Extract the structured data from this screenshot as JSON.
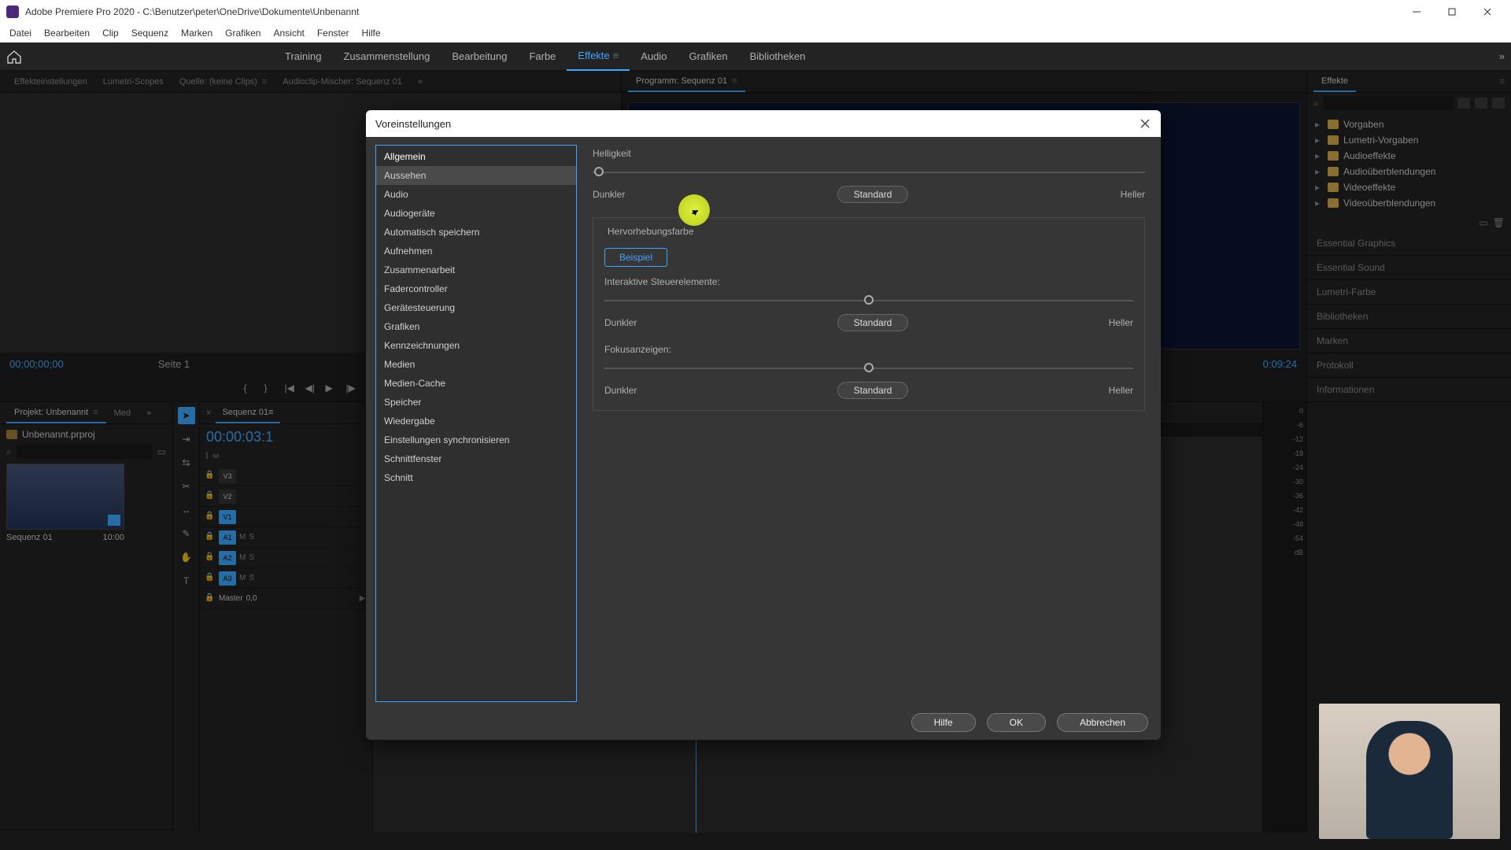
{
  "window": {
    "title": "Adobe Premiere Pro 2020 - C:\\Benutzer\\peter\\OneDrive\\Dokumente\\Unbenannt"
  },
  "menu": [
    "Datei",
    "Bearbeiten",
    "Clip",
    "Sequenz",
    "Marken",
    "Grafiken",
    "Ansicht",
    "Fenster",
    "Hilfe"
  ],
  "workspaces": {
    "items": [
      "Training",
      "Zusammenstellung",
      "Bearbeitung",
      "Farbe",
      "Effekte",
      "Audio",
      "Grafiken",
      "Bibliotheken"
    ],
    "active": "Effekte"
  },
  "source_tabs": [
    "Effekteinstellungen",
    "Lumetri-Scopes",
    "Quelle: (keine Clips)",
    "Audioclip-Mischer: Sequenz 01"
  ],
  "program_tab": "Programm: Sequenz 01",
  "source_timecode": "00;00;00;00",
  "source_fit": "Seite 1",
  "program_timecode_right": "0:09:24",
  "effects_panel": {
    "title": "Effekte",
    "search_placeholder": "",
    "tree": [
      "Vorgaben",
      "Lumetri-Vorgaben",
      "Audioeffekte",
      "Audioüberblendungen",
      "Videoeffekte",
      "Videoüberblendungen"
    ]
  },
  "right_stack": [
    "Essential Graphics",
    "Essential Sound",
    "Lumetri-Farbe",
    "Bibliotheken",
    "Marken",
    "Protokoll",
    "Informationen"
  ],
  "project": {
    "tab": "Projekt: Unbenannt",
    "media_tab": "Med",
    "filename": "Unbenannt.prproj",
    "clip_name": "Sequenz 01",
    "clip_dur": "10:00"
  },
  "timeline": {
    "tab": "Sequenz 01",
    "timecode": "00:00:03:1",
    "tracks_v": [
      "V3",
      "V2",
      "V1"
    ],
    "tracks_a": [
      "A1",
      "A2",
      "A3"
    ],
    "master": "Master",
    "master_val": "0,0"
  },
  "meters": [
    "0",
    "-6",
    "-12",
    "-18",
    "-24",
    "-30",
    "-36",
    "-42",
    "-48",
    "-54",
    "dB"
  ],
  "dialog": {
    "title": "Voreinstellungen",
    "sidebar": [
      "Allgemein",
      "Aussehen",
      "Audio",
      "Audiogeräte",
      "Automatisch speichern",
      "Aufnehmen",
      "Zusammenarbeit",
      "Fadercontroller",
      "Gerätesteuerung",
      "Grafiken",
      "Kennzeichnungen",
      "Medien",
      "Medien-Cache",
      "Speicher",
      "Wiedergabe",
      "Einstellungen synchronisieren",
      "Schnittfenster",
      "Schnitt"
    ],
    "sidebar_selected": "Aussehen",
    "brightness": {
      "label": "Helligkeit",
      "dark": "Dunkler",
      "std": "Standard",
      "light": "Heller"
    },
    "highlight": {
      "label": "Hervorhebungsfarbe",
      "example": "Beispiel",
      "interactive": "Interaktive Steuerelemente:",
      "focus": "Fokusanzeigen:",
      "dark": "Dunkler",
      "std": "Standard",
      "light": "Heller"
    },
    "buttons": {
      "help": "Hilfe",
      "ok": "OK",
      "cancel": "Abbrechen"
    }
  }
}
